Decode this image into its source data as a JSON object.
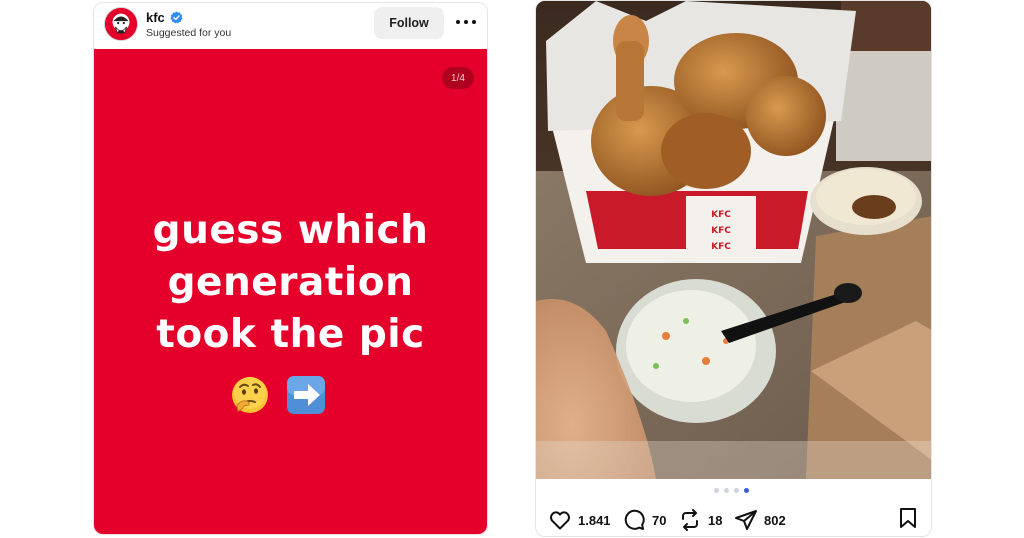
{
  "left_post": {
    "username": "kfc",
    "subtitle": "Suggested for you",
    "follow_label": "Follow",
    "slide_counter": "1/4",
    "slide_lines": [
      "guess which",
      "generation",
      "took the pic"
    ],
    "emojis": [
      "thinking-face-emoji",
      "right-arrow-emoji"
    ],
    "colors": {
      "brand_red": "#e4002b",
      "verified_blue": "#2f8cf0"
    }
  },
  "right_post": {
    "carousel": {
      "count": 4,
      "active_index": 3
    },
    "actions": {
      "likes": "1.841",
      "comments": "70",
      "reposts": "18",
      "shares": "802"
    },
    "icons": [
      "heart-icon",
      "comment-icon",
      "repost-icon",
      "share-icon",
      "bookmark-icon"
    ],
    "colors": {
      "active_dot": "#3b5bd6",
      "inactive_dot": "#cfd3da"
    }
  }
}
